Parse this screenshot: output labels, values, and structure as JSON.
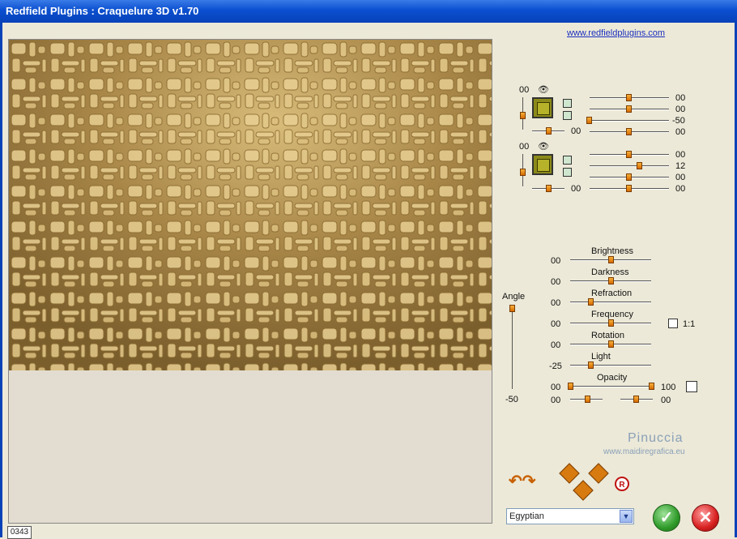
{
  "window": {
    "title": "Redfield Plugins : Craquelure 3D  v1.70"
  },
  "link": {
    "text": "www.redfieldplugins.com"
  },
  "zoom": {
    "value": "0343"
  },
  "layer1": {
    "angle": "00",
    "rows": [
      {
        "value": "00"
      },
      {
        "value": "00"
      },
      {
        "value": "-50"
      },
      {
        "value": "00"
      }
    ],
    "bottom_value": "00"
  },
  "layer2": {
    "angle": "00",
    "rows": [
      {
        "value": "00"
      },
      {
        "value": "12"
      },
      {
        "value": "00"
      },
      {
        "value": "00"
      }
    ],
    "bottom_value": "00"
  },
  "params": {
    "brightness": {
      "label": "Brightness",
      "value": "00"
    },
    "darkness": {
      "label": "Darkness",
      "value": "00"
    },
    "refraction": {
      "label": "Refraction",
      "value": "00"
    },
    "frequency": {
      "label": "Frequency",
      "value": "00"
    },
    "rotation": {
      "label": "Rotation",
      "value": "00"
    },
    "light": {
      "label": "Light",
      "value": "-25"
    },
    "opacity": {
      "label": "Opacity",
      "min": "00",
      "max": "100"
    },
    "extra": {
      "left": "00",
      "right": "00"
    },
    "ratio_label": "1:1"
  },
  "angle": {
    "label": "Angle",
    "value": "-50"
  },
  "signature": {
    "name": "Pinuccia",
    "site": "www.maidiregrafica.eu"
  },
  "preset": {
    "selected": "Egyptian"
  },
  "icons": {
    "eye": "eye-icon",
    "ok": "check-icon",
    "cancel": "close-icon",
    "reset": "reset-icon"
  }
}
